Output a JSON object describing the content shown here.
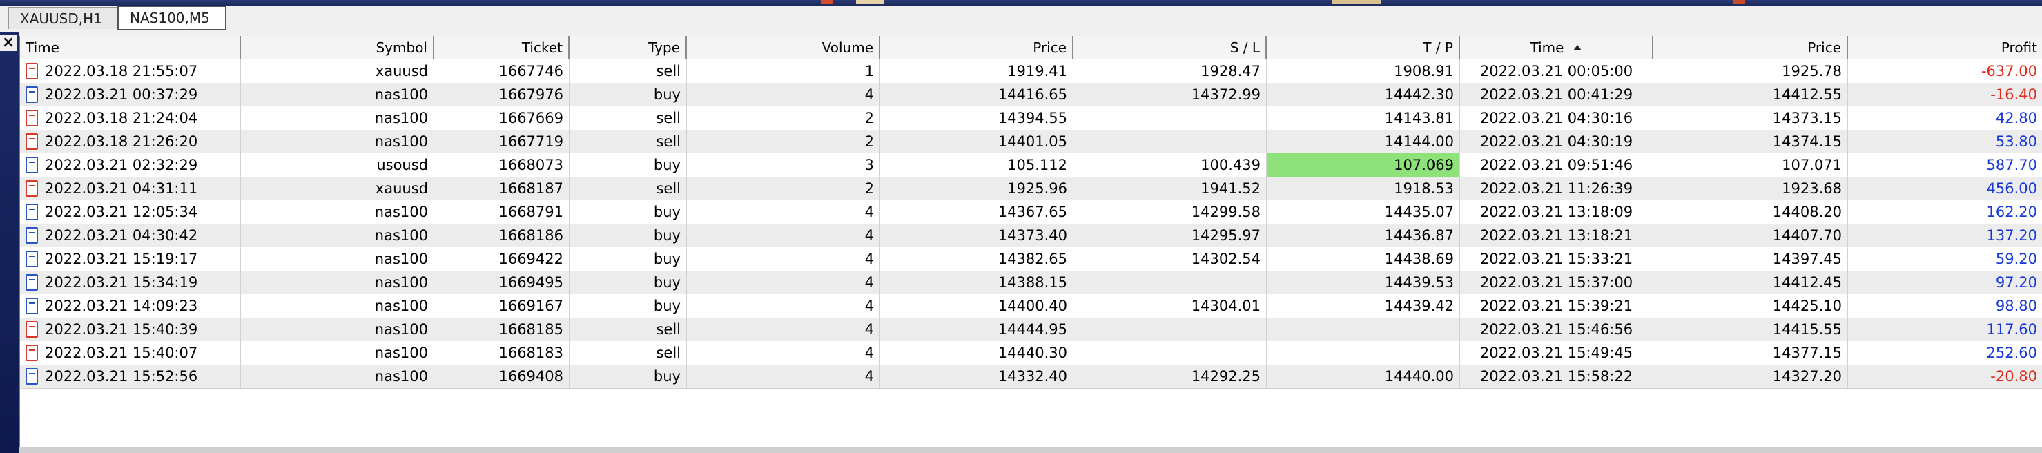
{
  "tabs": [
    {
      "label": "XAUUSD,H1",
      "active": false
    },
    {
      "label": "NAS100,M5",
      "active": true
    }
  ],
  "close_glyph": "×",
  "table": {
    "columns": [
      "Time",
      "Symbol",
      "Ticket",
      "Type",
      "Volume",
      "Price",
      "S / L",
      "T / P",
      "Time",
      "Price",
      "Profit"
    ],
    "sorted_column_index": 8,
    "sort_direction": "ascending",
    "rows": [
      {
        "icon": "sell-ticket-icon",
        "open_time": "2022.03.18 21:55:07",
        "symbol": "xauusd",
        "ticket": "1667746",
        "type": "sell",
        "volume": "1",
        "open_price": "1919.41",
        "sl": "1928.47",
        "tp": "1908.91",
        "close_time": "2022.03.21 00:05:00",
        "close_price": "1925.78",
        "profit": "-637.00",
        "profit_sign": "neg",
        "tp_highlight": false
      },
      {
        "icon": "buy-ticket-icon",
        "open_time": "2022.03.21 00:37:29",
        "symbol": "nas100",
        "ticket": "1667976",
        "type": "buy",
        "volume": "4",
        "open_price": "14416.65",
        "sl": "14372.99",
        "tp": "14442.30",
        "close_time": "2022.03.21 00:41:29",
        "close_price": "14412.55",
        "profit": "-16.40",
        "profit_sign": "neg",
        "tp_highlight": false
      },
      {
        "icon": "sell-ticket-icon",
        "open_time": "2022.03.18 21:24:04",
        "symbol": "nas100",
        "ticket": "1667669",
        "type": "sell",
        "volume": "2",
        "open_price": "14394.55",
        "sl": "",
        "tp": "14143.81",
        "close_time": "2022.03.21 04:30:16",
        "close_price": "14373.15",
        "profit": "42.80",
        "profit_sign": "pos",
        "tp_highlight": false
      },
      {
        "icon": "sell-ticket-icon",
        "open_time": "2022.03.18 21:26:20",
        "symbol": "nas100",
        "ticket": "1667719",
        "type": "sell",
        "volume": "2",
        "open_price": "14401.05",
        "sl": "",
        "tp": "14144.00",
        "close_time": "2022.03.21 04:30:19",
        "close_price": "14374.15",
        "profit": "53.80",
        "profit_sign": "pos",
        "tp_highlight": false
      },
      {
        "icon": "buy-ticket-icon",
        "open_time": "2022.03.21 02:32:29",
        "symbol": "usousd",
        "ticket": "1668073",
        "type": "buy",
        "volume": "3",
        "open_price": "105.112",
        "sl": "100.439",
        "tp": "107.069",
        "close_time": "2022.03.21 09:51:46",
        "close_price": "107.071",
        "profit": "587.70",
        "profit_sign": "pos",
        "tp_highlight": true
      },
      {
        "icon": "sell-ticket-icon",
        "open_time": "2022.03.21 04:31:11",
        "symbol": "xauusd",
        "ticket": "1668187",
        "type": "sell",
        "volume": "2",
        "open_price": "1925.96",
        "sl": "1941.52",
        "tp": "1918.53",
        "close_time": "2022.03.21 11:26:39",
        "close_price": "1923.68",
        "profit": "456.00",
        "profit_sign": "pos",
        "tp_highlight": false
      },
      {
        "icon": "buy-ticket-icon",
        "open_time": "2022.03.21 12:05:34",
        "symbol": "nas100",
        "ticket": "1668791",
        "type": "buy",
        "volume": "4",
        "open_price": "14367.65",
        "sl": "14299.58",
        "tp": "14435.07",
        "close_time": "2022.03.21 13:18:09",
        "close_price": "14408.20",
        "profit": "162.20",
        "profit_sign": "pos",
        "tp_highlight": false
      },
      {
        "icon": "buy-ticket-icon",
        "open_time": "2022.03.21 04:30:42",
        "symbol": "nas100",
        "ticket": "1668186",
        "type": "buy",
        "volume": "4",
        "open_price": "14373.40",
        "sl": "14295.97",
        "tp": "14436.87",
        "close_time": "2022.03.21 13:18:21",
        "close_price": "14407.70",
        "profit": "137.20",
        "profit_sign": "pos",
        "tp_highlight": false
      },
      {
        "icon": "buy-ticket-icon",
        "open_time": "2022.03.21 15:19:17",
        "symbol": "nas100",
        "ticket": "1669422",
        "type": "buy",
        "volume": "4",
        "open_price": "14382.65",
        "sl": "14302.54",
        "tp": "14438.69",
        "close_time": "2022.03.21 15:33:21",
        "close_price": "14397.45",
        "profit": "59.20",
        "profit_sign": "pos",
        "tp_highlight": false
      },
      {
        "icon": "buy-ticket-icon",
        "open_time": "2022.03.21 15:34:19",
        "symbol": "nas100",
        "ticket": "1669495",
        "type": "buy",
        "volume": "4",
        "open_price": "14388.15",
        "sl": "",
        "tp": "14439.53",
        "close_time": "2022.03.21 15:37:00",
        "close_price": "14412.45",
        "profit": "97.20",
        "profit_sign": "pos",
        "tp_highlight": false
      },
      {
        "icon": "buy-ticket-icon",
        "open_time": "2022.03.21 14:09:23",
        "symbol": "nas100",
        "ticket": "1669167",
        "type": "buy",
        "volume": "4",
        "open_price": "14400.40",
        "sl": "14304.01",
        "tp": "14439.42",
        "close_time": "2022.03.21 15:39:21",
        "close_price": "14425.10",
        "profit": "98.80",
        "profit_sign": "pos",
        "tp_highlight": false
      },
      {
        "icon": "sell-ticket-icon",
        "open_time": "2022.03.21 15:40:39",
        "symbol": "nas100",
        "ticket": "1668185",
        "type": "sell",
        "volume": "4",
        "open_price": "14444.95",
        "sl": "",
        "tp": "",
        "close_time": "2022.03.21 15:46:56",
        "close_price": "14415.55",
        "profit": "117.60",
        "profit_sign": "pos",
        "tp_highlight": false
      },
      {
        "icon": "sell-ticket-icon",
        "open_time": "2022.03.21 15:40:07",
        "symbol": "nas100",
        "ticket": "1668183",
        "type": "sell",
        "volume": "4",
        "open_price": "14440.30",
        "sl": "",
        "tp": "",
        "close_time": "2022.03.21 15:49:45",
        "close_price": "14377.15",
        "profit": "252.60",
        "profit_sign": "pos",
        "tp_highlight": false
      },
      {
        "icon": "buy-ticket-icon",
        "open_time": "2022.03.21 15:52:56",
        "symbol": "nas100",
        "ticket": "1669408",
        "type": "buy",
        "volume": "4",
        "open_price": "14332.40",
        "sl": "14292.25",
        "tp": "14440.00",
        "close_time": "2022.03.21 15:58:22",
        "close_price": "14327.20",
        "profit": "-20.80",
        "profit_sign": "neg",
        "tp_highlight": false
      }
    ]
  },
  "colors": {
    "profit_negative": "#e02a1a",
    "profit_positive": "#1537d8",
    "tp_highlight": "#8fe27a",
    "rail": "#1b2a66"
  }
}
